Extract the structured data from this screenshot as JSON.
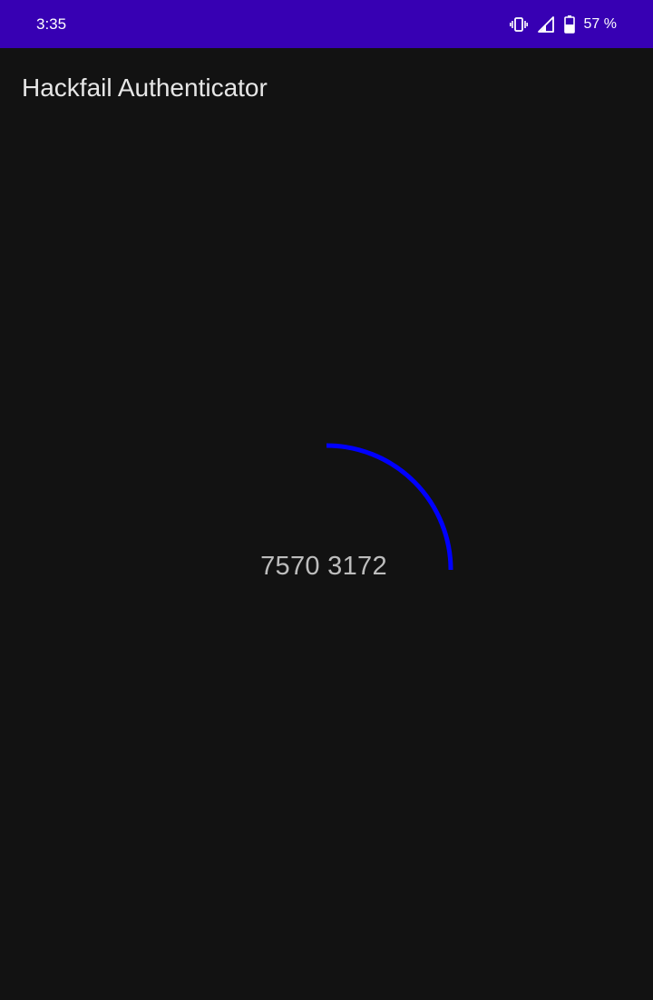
{
  "status_bar": {
    "time": "3:35",
    "battery_percent": "57 %",
    "icons": [
      "vibrate-icon",
      "signal-icon",
      "battery-icon"
    ],
    "background_color": "#3700b3"
  },
  "app": {
    "title": "Hackfail Authenticator"
  },
  "token": {
    "code": "7570 3172",
    "remaining_fraction": 0.25,
    "ring_color": "#0000ff"
  }
}
